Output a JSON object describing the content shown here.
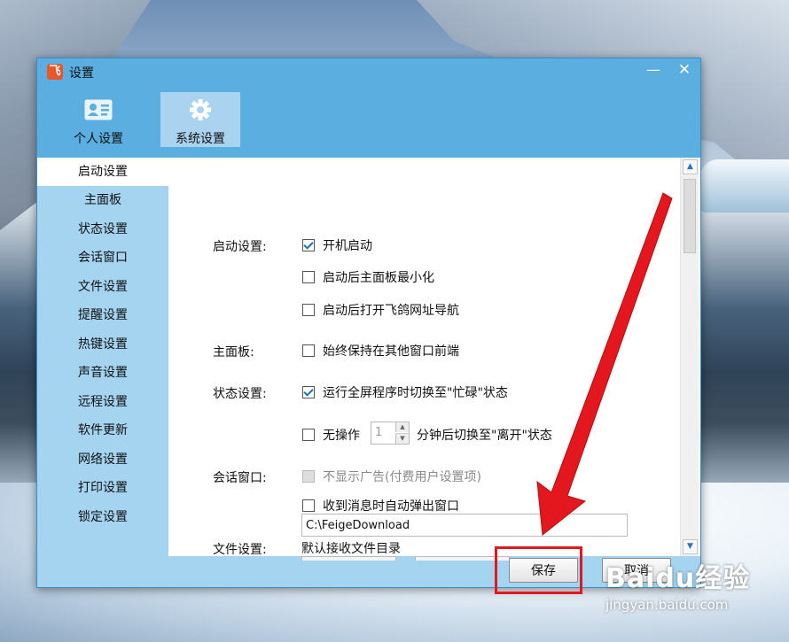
{
  "window": {
    "title": "设置",
    "logo_glyph": "飞",
    "minimize_glyph": "—",
    "close_glyph": "✕"
  },
  "tabs": [
    {
      "label": "个人设置",
      "icon": "contact-card-icon",
      "active": false
    },
    {
      "label": "系统设置",
      "icon": "gear-icon",
      "active": true
    }
  ],
  "sidebar": {
    "items": [
      {
        "label": "启动设置",
        "active": true
      },
      {
        "label": "主面板"
      },
      {
        "label": "状态设置"
      },
      {
        "label": "会话窗口"
      },
      {
        "label": "文件设置"
      },
      {
        "label": "提醒设置"
      },
      {
        "label": "热键设置"
      },
      {
        "label": "声音设置"
      },
      {
        "label": "远程设置"
      },
      {
        "label": "软件更新"
      },
      {
        "label": "网络设置"
      },
      {
        "label": "打印设置"
      },
      {
        "label": "锁定设置"
      }
    ]
  },
  "content": {
    "startup": {
      "label": "启动设置:",
      "options": [
        {
          "label": "开机启动",
          "checked": true
        },
        {
          "label": "启动后主面板最小化",
          "checked": false
        },
        {
          "label": "启动后打开飞鸽网址导航",
          "checked": false
        }
      ]
    },
    "main_panel": {
      "label": "主面板:",
      "options": [
        {
          "label": "始终保持在其他窗口前端",
          "checked": false
        }
      ]
    },
    "status": {
      "label": "状态设置:",
      "option_fullscreen": {
        "label": "运行全屏程序时切换至\"忙碌\"状态",
        "checked": true
      },
      "option_idle": {
        "prefix": "无操作",
        "minutes": "1",
        "suffix": "分钟后切换至\"离开\"状态",
        "checked": false
      }
    },
    "chat_window": {
      "label": "会话窗口:",
      "options": [
        {
          "label": "不显示广告(付费用户设置项)",
          "checked": false,
          "disabled": true
        },
        {
          "label": "收到消息时自动弹出窗口",
          "checked": false
        }
      ]
    },
    "file": {
      "label": "文件设置:",
      "default_dir_label": "默认接收文件目录",
      "default_dir_value": "C:\\FeigeDownload"
    }
  },
  "footer": {
    "save_label": "保存",
    "cancel_label": "取消"
  },
  "annotation": {
    "highlight_color": "#e3171d"
  },
  "watermark": {
    "line1": "Baidu经验",
    "line2": "jingyan.baidu.com"
  }
}
